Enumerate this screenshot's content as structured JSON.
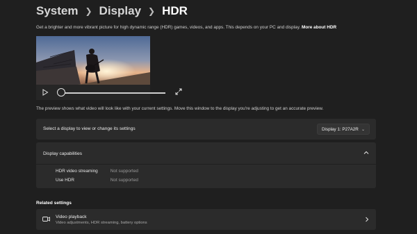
{
  "breadcrumb": {
    "items": [
      "System",
      "Display",
      "HDR"
    ]
  },
  "header": {
    "description": "Get a brighter and more vibrant picture for high dynamic range (HDR) games, videos, and apps. This depends on your PC and display.",
    "more_link": "More about HDR"
  },
  "player": {
    "play_icon": "play-icon",
    "expand_icon": "expand-icon",
    "progress": 0.0
  },
  "preview_note": "The preview shows what video will look like with your current settings. Move this window to the display you're adjusting to get an accurate preview.",
  "display_select": {
    "label": "Select a display to view or change its settings",
    "value": "Display 1: P27A2R"
  },
  "capabilities": {
    "title": "Display capabilities",
    "rows": [
      {
        "name": "HDR video streaming",
        "value": "Not supported"
      },
      {
        "name": "Use HDR",
        "value": "Not supported"
      }
    ]
  },
  "related": {
    "title": "Related settings",
    "video_playback": {
      "title": "Video playback",
      "subtitle": "Video adjustments, HDR streaming, battery options"
    }
  },
  "colors": {
    "background": "#1f1f1f",
    "card": "#2b2b2b",
    "text": "#ffffff",
    "muted": "#9a9a9a"
  }
}
